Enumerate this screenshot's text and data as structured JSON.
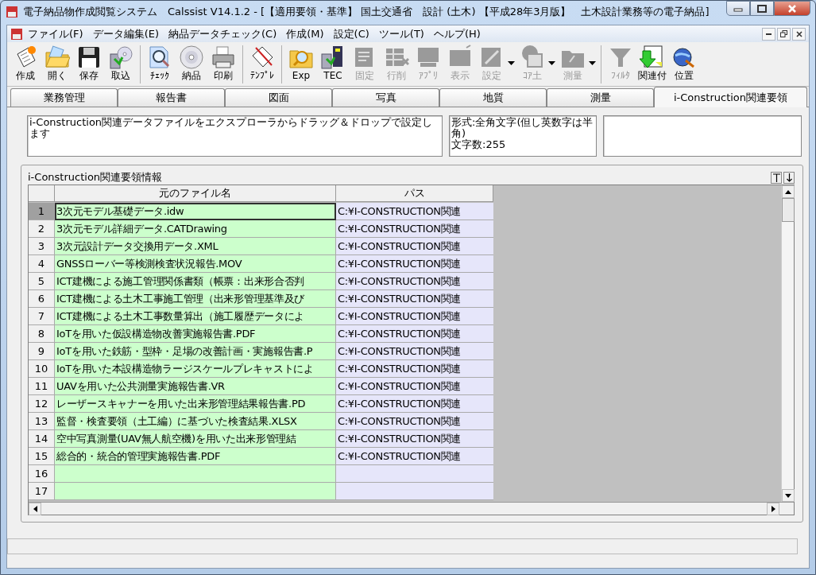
{
  "window": {
    "title": "電子納品物作成閲覧システム　Calssist V14.1.2 - [【適用要領・基準】 国土交通省　設計 (土木) 【平成28年3月版】　土木設計業務等の電子納品]"
  },
  "menu": [
    "ファイル(F)",
    "データ編集(E)",
    "納品データチェック(C)",
    "作成(M)",
    "設定(C)",
    "ツール(T)",
    "ヘルプ(H)"
  ],
  "toolbar": [
    [
      {
        "label": "作成",
        "disabled": false,
        "dropdown": false
      },
      {
        "label": "開く",
        "disabled": false,
        "dropdown": false
      },
      {
        "label": "保存",
        "disabled": false,
        "dropdown": false
      },
      {
        "label": "取込",
        "disabled": false,
        "dropdown": false
      }
    ],
    [
      {
        "label": "ﾁｪｯｸ",
        "disabled": false,
        "dropdown": false
      },
      {
        "label": "納品",
        "disabled": false,
        "dropdown": false
      },
      {
        "label": "印刷",
        "disabled": false,
        "dropdown": false
      }
    ],
    [
      {
        "label": "ﾃﾝﾌﾟﾚ",
        "disabled": false,
        "dropdown": false
      }
    ],
    [
      {
        "label": "Exp",
        "disabled": false,
        "dropdown": false
      },
      {
        "label": "TEC",
        "disabled": false,
        "dropdown": false
      },
      {
        "label": "固定",
        "disabled": true,
        "dropdown": false
      },
      {
        "label": "行削",
        "disabled": true,
        "dropdown": false
      },
      {
        "label": "ｱﾌﾟﾘ",
        "disabled": true,
        "dropdown": false
      },
      {
        "label": "表示",
        "disabled": true,
        "dropdown": false
      },
      {
        "label": "設定",
        "disabled": true,
        "dropdown": true
      },
      {
        "label": "ｺｱ土",
        "disabled": true,
        "dropdown": true
      },
      {
        "label": "測量",
        "disabled": true,
        "dropdown": true
      }
    ],
    [
      {
        "label": "ﾌｨﾙﾀ",
        "disabled": true,
        "dropdown": false
      },
      {
        "label": "関連付",
        "disabled": false,
        "dropdown": false
      },
      {
        "label": "位置",
        "disabled": false,
        "dropdown": false
      }
    ]
  ],
  "tabs": [
    {
      "label": "業務管理",
      "selected": false
    },
    {
      "label": "報告書",
      "selected": false
    },
    {
      "label": "図面",
      "selected": false
    },
    {
      "label": "写真",
      "selected": false
    },
    {
      "label": "地質",
      "selected": false
    },
    {
      "label": "測量",
      "selected": false
    },
    {
      "label": "i-Construction関連要領",
      "selected": true
    }
  ],
  "description": "i-Construction関連データファイルをエクスプローラからドラッグ＆ドロップで設定します",
  "format": {
    "rule": "形式:全角文字(但し英数字は半角)",
    "count": "文字数:255"
  },
  "section_title": "i-Construction関連要領情報",
  "table": {
    "columns": [
      "元のファイル名",
      "パス"
    ],
    "rows": [
      {
        "number": "1",
        "selected": true,
        "file": "3次元モデル基礎データ.idw",
        "path": "C:¥I-CONSTRUCTION関連"
      },
      {
        "number": "2",
        "selected": false,
        "file": "3次元モデル詳細データ.CATDrawing",
        "path": "C:¥I-CONSTRUCTION関連"
      },
      {
        "number": "3",
        "selected": false,
        "file": "3次元設計データ交換用データ.XML",
        "path": "C:¥I-CONSTRUCTION関連"
      },
      {
        "number": "4",
        "selected": false,
        "file": "GNSSローバー等検測検査状況報告.MOV",
        "path": "C:¥I-CONSTRUCTION関連"
      },
      {
        "number": "5",
        "selected": false,
        "file": "ICT建機による施工管理関係書類（帳票：出来形合否判",
        "path": "C:¥I-CONSTRUCTION関連"
      },
      {
        "number": "6",
        "selected": false,
        "file": "ICT建機による土木工事施工管理（出来形管理基準及び",
        "path": "C:¥I-CONSTRUCTION関連"
      },
      {
        "number": "7",
        "selected": false,
        "file": "ICT建機による土木工事数量算出（施工履歴データによ",
        "path": "C:¥I-CONSTRUCTION関連"
      },
      {
        "number": "8",
        "selected": false,
        "file": "IoTを用いた仮設構造物改善実施報告書.PDF",
        "path": "C:¥I-CONSTRUCTION関連"
      },
      {
        "number": "9",
        "selected": false,
        "file": "IoTを用いた鉄筋・型枠・足場の改善計画・実施報告書.P",
        "path": "C:¥I-CONSTRUCTION関連"
      },
      {
        "number": "10",
        "selected": false,
        "file": "IoTを用いた本設構造物ラージスケールプレキャストによ",
        "path": "C:¥I-CONSTRUCTION関連"
      },
      {
        "number": "11",
        "selected": false,
        "file": "UAVを用いた公共測量実施報告書.VR",
        "path": "C:¥I-CONSTRUCTION関連"
      },
      {
        "number": "12",
        "selected": false,
        "file": "レーザースキャナーを用いた出来形管理結果報告書.PD",
        "path": "C:¥I-CONSTRUCTION関連"
      },
      {
        "number": "13",
        "selected": false,
        "file": "監督・検査要領（土工編）に基づいた検査結果.XLSX",
        "path": "C:¥I-CONSTRUCTION関連"
      },
      {
        "number": "14",
        "selected": false,
        "file": "空中写真測量(UAV無人航空機)を用いた出来形管理結",
        "path": "C:¥I-CONSTRUCTION関連"
      },
      {
        "number": "15",
        "selected": false,
        "file": "総合的・統合的管理実施報告書.PDF",
        "path": "C:¥I-CONSTRUCTION関連"
      },
      {
        "number": "16",
        "selected": false
      },
      {
        "number": "17",
        "selected": false
      }
    ]
  }
}
